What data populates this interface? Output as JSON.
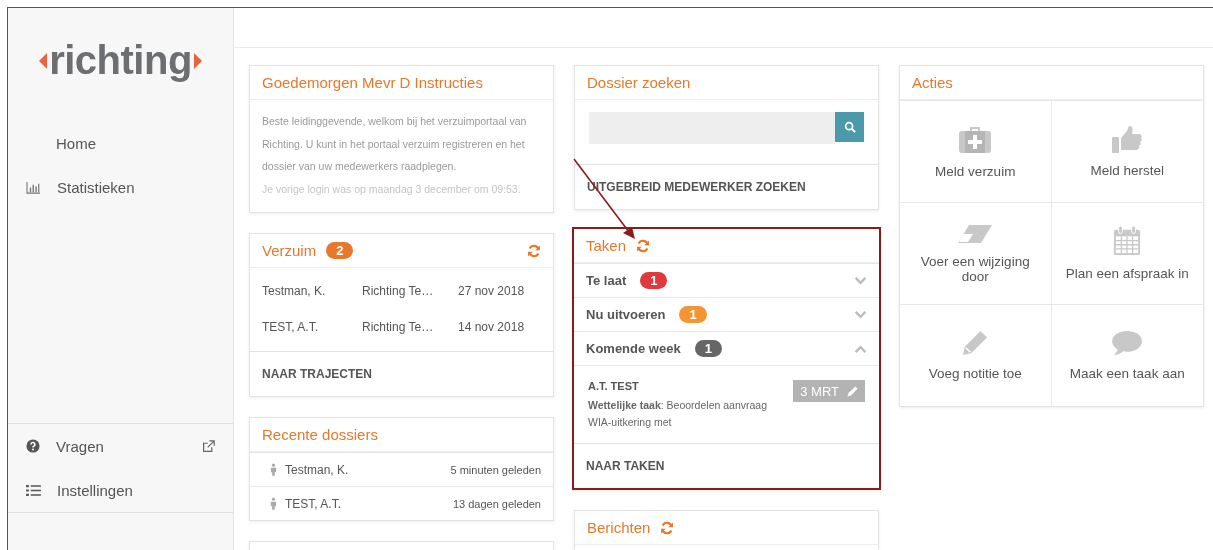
{
  "logo": {
    "text": "richting"
  },
  "sidebar": {
    "items": [
      {
        "label": "Home"
      },
      {
        "label": "Statistieken"
      }
    ],
    "bottom_items": [
      {
        "label": "Vragen"
      },
      {
        "label": "Instellingen"
      }
    ]
  },
  "welcome": {
    "title": "Goedemorgen Mevr D Instructies",
    "text": "Beste leidinggevende, welkom bij het verzuimportaal van Richting. U kunt in het portaal verzuim registreren en het dossier van uw medewerkers raadplegen.",
    "last_login": "Je vorige login was op maandag 3 december om 09:53."
  },
  "verzuim": {
    "title": "Verzuim",
    "count": "2",
    "rows": [
      {
        "name": "Testman, K.",
        "organisation": "Richting Te…",
        "date": "27 nov 2018"
      },
      {
        "name": "TEST, A.T.",
        "organisation": "Richting Te…",
        "date": "14 nov 2018"
      }
    ],
    "footer_link": "NAAR TRAJECTEN"
  },
  "recent": {
    "title": "Recente dossiers",
    "rows": [
      {
        "name": "Testman, K.",
        "time": "5 minuten geleden"
      },
      {
        "name": "TEST, A.T.",
        "time": "13 dagen geleden"
      }
    ]
  },
  "search": {
    "title": "Dossier zoeken",
    "footer_link": "UITGEBREID MEDEWERKER ZOEKEN"
  },
  "tasks": {
    "title": "Taken",
    "highlighted": true,
    "groups": [
      {
        "label": "Te laat",
        "count": "1",
        "color": "#e0383f",
        "expanded": false
      },
      {
        "label": "Nu uitvoeren",
        "count": "1",
        "color": "#f39530",
        "expanded": false
      },
      {
        "label": "Komende week",
        "count": "1",
        "color": "#666666",
        "expanded": true,
        "items": [
          {
            "name": "A.T. TEST",
            "due": "3 MRT",
            "description": "**Wettelijke taak**: Beoordelen aanvraag WIA-uitkering met"
          }
        ]
      }
    ],
    "footer_link": "NAAR TAKEN"
  },
  "messages": {
    "title": "Berichten"
  },
  "actions": {
    "title": "Acties",
    "items": [
      {
        "label": "Meld verzuim"
      },
      {
        "label": "Meld herstel"
      },
      {
        "label": "Voer een wijziging door"
      },
      {
        "label": "Plan een afspraak in"
      },
      {
        "label": "Voeg notitie toe"
      },
      {
        "label": "Maak een taak aan"
      }
    ]
  }
}
